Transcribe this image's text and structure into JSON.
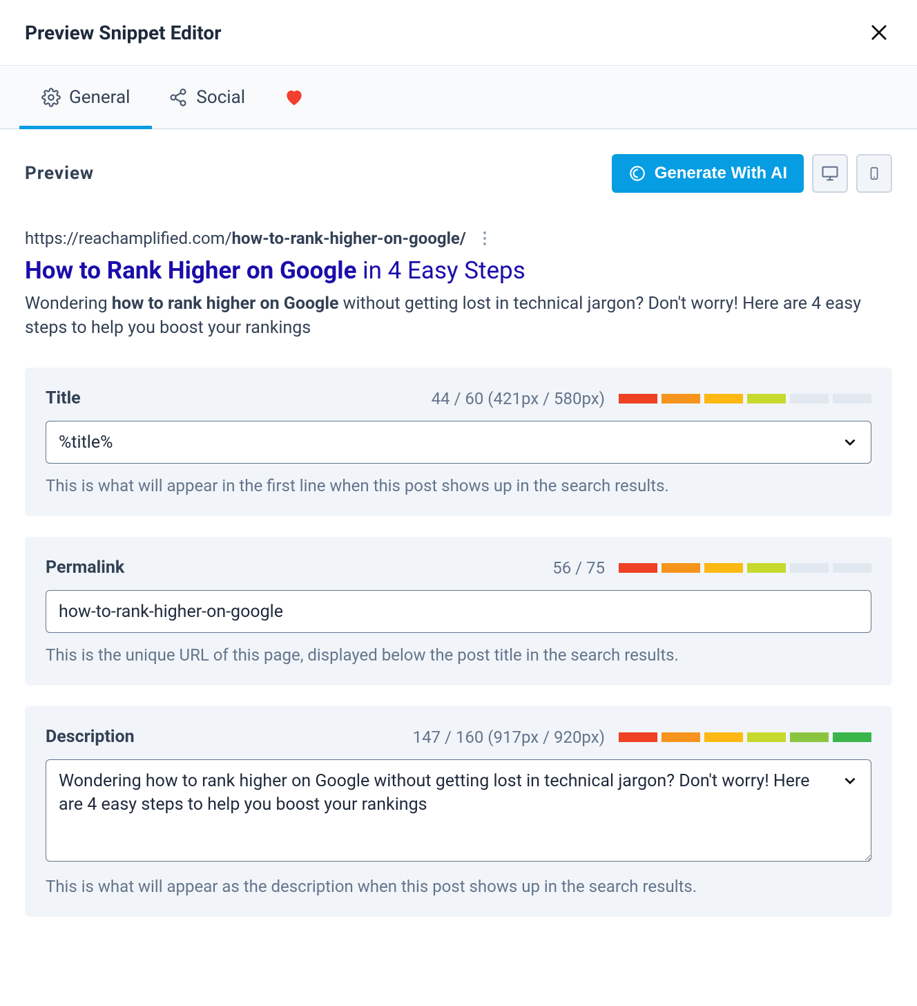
{
  "header": {
    "title": "Preview Snippet Editor"
  },
  "tabs": {
    "general": {
      "label": "General"
    },
    "social": {
      "label": "Social"
    }
  },
  "preview": {
    "heading": "Preview",
    "generate_label": "Generate With AI",
    "serp": {
      "url_base": "https://reachamplified.com/",
      "url_slug": "how-to-rank-higher-on-google/",
      "title_bold": "How to Rank Higher on Google",
      "title_rest": " in 4 Easy Steps",
      "desc_prefix": "Wondering ",
      "desc_bold": "how to rank higher on Google",
      "desc_suffix": " without getting lost in technical jargon? Don't worry! Here are 4 easy steps to help you boost your rankings"
    }
  },
  "fields": {
    "title": {
      "label": "Title",
      "counter": "44 / 60 (421px / 580px)",
      "value": "%title%",
      "helper": "This is what will appear in the first line when this post shows up in the search results.",
      "meter_fill": 4,
      "meter_colors": [
        "#ef4123",
        "#f7941d",
        "#fdb814",
        "#c6d92d",
        "#e2e8f0",
        "#e2e8f0"
      ]
    },
    "permalink": {
      "label": "Permalink",
      "counter": "56 / 75",
      "value": "how-to-rank-higher-on-google",
      "helper": "This is the unique URL of this page, displayed below the post title in the search results.",
      "meter_colors": [
        "#ef4123",
        "#f7941d",
        "#fdb814",
        "#c6d92d",
        "#e2e8f0",
        "#e2e8f0"
      ]
    },
    "description": {
      "label": "Description",
      "counter": "147 / 160 (917px / 920px)",
      "value": "Wondering how to rank higher on Google without getting lost in technical jargon? Don't worry! Here are 4 easy steps to help you boost your rankings",
      "helper": "This is what will appear as the description when this post shows up in the search results.",
      "meter_colors": [
        "#ef4123",
        "#f7941d",
        "#fdb814",
        "#c6d92d",
        "#8bc53f",
        "#39b54a"
      ]
    }
  }
}
